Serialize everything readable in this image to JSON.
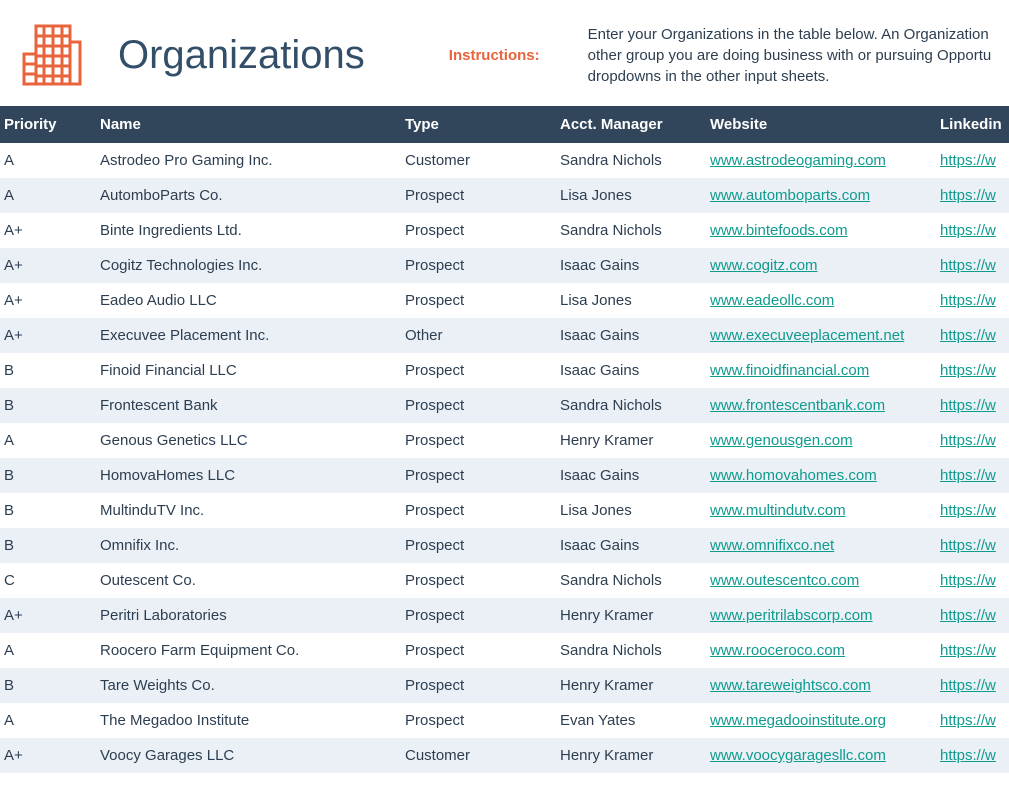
{
  "header": {
    "title": "Organizations",
    "instructions_label": "Instructions:",
    "instructions_text": "Enter your Organizations in the table below. An Organization other group you are doing business with or pursuing Opportu dropdowns in the other input sheets."
  },
  "columns": [
    "Priority",
    "Name",
    "Type",
    "Acct. Manager",
    "Website",
    "Linkedin"
  ],
  "rows": [
    {
      "priority": "A",
      "name": "Astrodeo Pro Gaming Inc.",
      "type": "Customer",
      "manager": "Sandra Nichols",
      "website": "www.astrodeogaming.com",
      "linkedin": "https://w"
    },
    {
      "priority": "A",
      "name": "AutomboParts Co.",
      "type": "Prospect",
      "manager": "Lisa Jones",
      "website": "www.automboparts.com",
      "linkedin": "https://w"
    },
    {
      "priority": "A+",
      "name": "Binte Ingredients Ltd.",
      "type": "Prospect",
      "manager": "Sandra Nichols",
      "website": "www.bintefoods.com",
      "linkedin": "https://w"
    },
    {
      "priority": "A+",
      "name": "Cogitz Technologies Inc.",
      "type": "Prospect",
      "manager": "Isaac Gains",
      "website": "www.cogitz.com",
      "linkedin": "https://w"
    },
    {
      "priority": "A+",
      "name": "Eadeo Audio LLC",
      "type": "Prospect",
      "manager": "Lisa Jones",
      "website": "www.eadeollc.com",
      "linkedin": "https://w"
    },
    {
      "priority": "A+",
      "name": "Execuvee Placement Inc.",
      "type": "Other",
      "manager": "Isaac Gains",
      "website": "www.execuveeplacement.net",
      "linkedin": "https://w"
    },
    {
      "priority": "B",
      "name": "Finoid Financial LLC",
      "type": "Prospect",
      "manager": "Isaac Gains",
      "website": "www.finoidfinancial.com",
      "linkedin": "https://w"
    },
    {
      "priority": "B",
      "name": "Frontescent Bank",
      "type": "Prospect",
      "manager": "Sandra Nichols",
      "website": "www.frontescentbank.com",
      "linkedin": "https://w"
    },
    {
      "priority": "A",
      "name": "Genous Genetics LLC",
      "type": "Prospect",
      "manager": "Henry Kramer",
      "website": "www.genousgen.com",
      "linkedin": "https://w"
    },
    {
      "priority": "B",
      "name": "HomovaHomes LLC",
      "type": "Prospect",
      "manager": "Isaac Gains",
      "website": "www.homovahomes.com",
      "linkedin": "https://w"
    },
    {
      "priority": "B",
      "name": "MultinduTV Inc.",
      "type": "Prospect",
      "manager": "Lisa Jones",
      "website": "www.multindutv.com",
      "linkedin": "https://w"
    },
    {
      "priority": "B",
      "name": "Omnifix Inc.",
      "type": "Prospect",
      "manager": "Isaac Gains",
      "website": "www.omnifixco.net",
      "linkedin": "https://w"
    },
    {
      "priority": "C",
      "name": "Outescent Co.",
      "type": "Prospect",
      "manager": "Sandra Nichols",
      "website": "www.outescentco.com",
      "linkedin": "https://w"
    },
    {
      "priority": "A+",
      "name": "Peritri Laboratories",
      "type": "Prospect",
      "manager": "Henry Kramer",
      "website": "www.peritrilabscorp.com",
      "linkedin": "https://w"
    },
    {
      "priority": "A",
      "name": "Roocero Farm Equipment Co.",
      "type": "Prospect",
      "manager": "Sandra Nichols",
      "website": "www.rooceroco.com",
      "linkedin": "https://w"
    },
    {
      "priority": "B",
      "name": "Tare Weights Co.",
      "type": "Prospect",
      "manager": "Henry Kramer",
      "website": "www.tareweightsco.com",
      "linkedin": "https://w"
    },
    {
      "priority": "A",
      "name": "The Megadoo Institute",
      "type": "Prospect",
      "manager": "Evan Yates",
      "website": "www.megadooinstitute.org",
      "linkedin": "https://w"
    },
    {
      "priority": "A+",
      "name": "Voocy Garages LLC",
      "type": "Customer",
      "manager": "Henry Kramer",
      "website": "www.voocygaragesllc.com",
      "linkedin": "https://w"
    }
  ]
}
